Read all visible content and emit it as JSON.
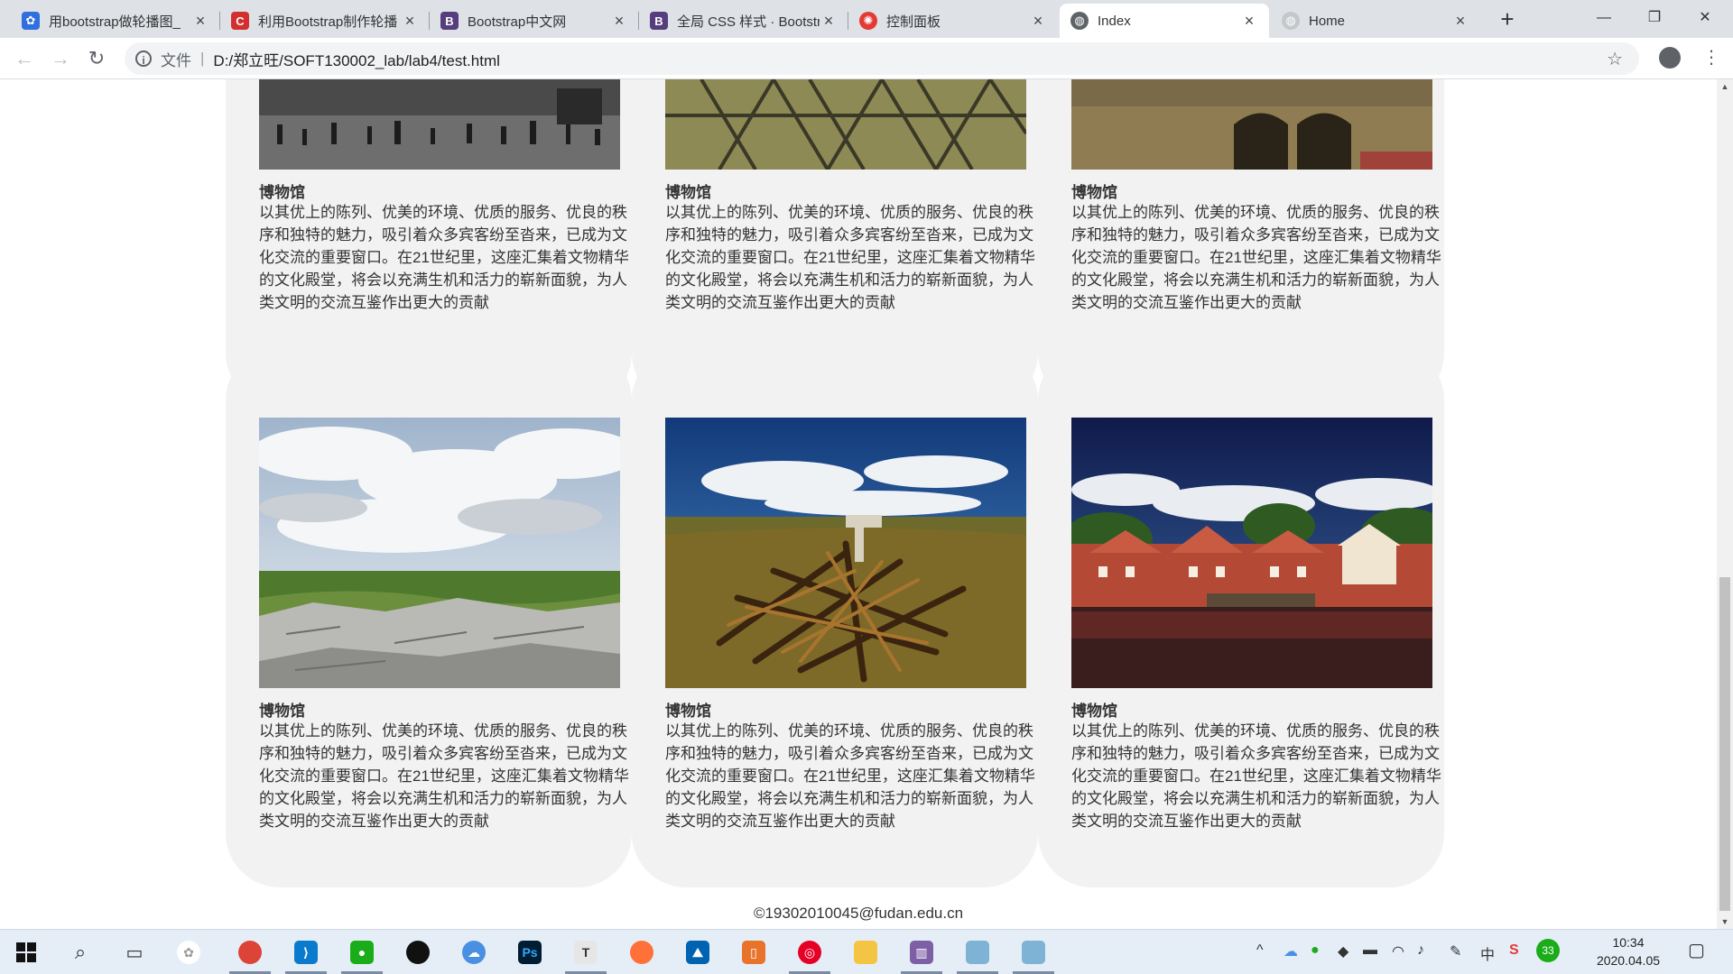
{
  "browser": {
    "tabs": [
      {
        "title": "用bootstrap做轮播图_",
        "icon": "baidu-paw-icon",
        "color": "#2f6fde"
      },
      {
        "title": "利用Bootstrap制作轮播",
        "icon": "csdn-icon",
        "color": "#d32f2f"
      },
      {
        "title": "Bootstrap中文网",
        "icon": "bootstrap-icon",
        "color": "#563d7c"
      },
      {
        "title": "全局 CSS 样式 · Bootstrap",
        "icon": "bootstrap-icon",
        "color": "#563d7c"
      },
      {
        "title": "控制面板",
        "icon": "gear-icon",
        "color": "#e53935"
      },
      {
        "title": "Index",
        "icon": "globe-icon",
        "color": "#5f6368"
      },
      {
        "title": "Home",
        "icon": "globe-icon",
        "color": "#9aa0a6"
      }
    ],
    "active_tab_index": 5,
    "new_tab_label": "+",
    "address": {
      "scheme_label": "文件",
      "separator": "|",
      "url": "D:/郑立旺/SOFT130002_lab/lab4/test.html"
    }
  },
  "page": {
    "cards": [
      {
        "title": "博物馆",
        "desc": "以其优上的陈列、优美的环境、优质的服务、优良的秩序和独特的魅力，吸引着众多宾客纷至沓来，已成为文化交流的重要窗口。在21世纪里，这座汇集着文物精华的文化殿堂，将会以充满生机和活力的崭新面貌，为人类文明的交流互鉴作出更大的贡献",
        "image": "black-white-plaza-crowd"
      },
      {
        "title": "博物馆",
        "desc": "以其优上的陈列、优美的环境、优质的服务、优良的秩序和独特的魅力，吸引着众多宾客纷至沓来，已成为文化交流的重要窗口。在21世纪里，这座汇集着文物精华的文化殿堂，将会以充满生机和活力的崭新面貌，为人类文明的交流互鉴作出更大的贡献",
        "image": "glass-roof-structure"
      },
      {
        "title": "博物馆",
        "desc": "以其优上的陈列、优美的环境、优质的服务、优良的秩序和独特的魅力，吸引着众多宾客纷至沓来，已成为文化交流的重要窗口。在21世纪里，这座汇集着文物精华的文化殿堂，将会以充满生机和活力的崭新面貌，为人类文明的交流互鉴作出更大的贡献",
        "image": "stone-wall-arches"
      },
      {
        "title": "博物馆",
        "desc": "以其优上的陈列、优美的环境、优质的服务、优良的秩序和独特的魅力，吸引着众多宾客纷至沓来，已成为文化交流的重要窗口。在21世纪里，这座汇集着文物精华的文化殿堂，将会以充满生机和活力的崭新面貌，为人类文明的交流互鉴作出更大的贡献",
        "image": "cloudy-sky-rocky-field"
      },
      {
        "title": "博物馆",
        "desc": "以其优上的陈列、优美的环境、优质的服务、优良的秩序和独特的魅力，吸引着众多宾客纷至沓来，已成为文化交流的重要窗口。在21世纪里，这座汇集着文物精华的文化殿堂，将会以充满生机和活力的崭新面貌，为人类文明的交流互鉴作出更大的贡献",
        "image": "driftwood-pile-field"
      },
      {
        "title": "博物馆",
        "desc": "以其优上的陈列、优美的环境、优质的服务、优良的秩序和独特的魅力，吸引着众多宾客纷至沓来，已成为文化交流的重要窗口。在21世纪里，这座汇集着文物精华的文化殿堂，将会以充满生机和活力的崭新面貌，为人类文明的交流互鉴作出更大的贡献",
        "image": "harbor-red-houses"
      }
    ],
    "footer": "©19302010045@fudan.edu.cn",
    "card_bg_color": "#f2f2f2"
  },
  "taskbar": {
    "apps": [
      {
        "name": "chrome",
        "icon": "chrome-icon",
        "color": "#db4437",
        "label": "",
        "running": true
      },
      {
        "name": "vscode",
        "icon": "vscode-icon",
        "color": "#0a7acc",
        "label": "",
        "running": true
      },
      {
        "name": "wechat",
        "icon": "wechat-icon",
        "color": "#1aad19",
        "label": "",
        "running": true
      },
      {
        "name": "qq",
        "icon": "qq-penguin-icon",
        "color": "#111111",
        "label": "",
        "running": false
      },
      {
        "name": "baidu-netdisk",
        "icon": "cloud-icon",
        "color": "#4a90e2",
        "label": "",
        "running": false
      },
      {
        "name": "photoshop",
        "icon": "photoshop-icon",
        "color": "#001d34",
        "label": "Ps",
        "running": false
      },
      {
        "name": "typora",
        "icon": "typora-icon",
        "color": "#e6e6e6",
        "label": "T",
        "running": true
      },
      {
        "name": "firefox",
        "icon": "firefox-icon",
        "color": "#ff7139",
        "label": "",
        "running": false
      },
      {
        "name": "photos",
        "icon": "photos-icon",
        "color": "#0063b1",
        "label": "",
        "running": false
      },
      {
        "name": "wps",
        "icon": "wps-icon",
        "color": "#e8732b",
        "label": "",
        "running": false
      },
      {
        "name": "netease-music",
        "icon": "music-icon",
        "color": "#e60026",
        "label": "",
        "running": true
      },
      {
        "name": "file-explorer",
        "icon": "folder-icon",
        "color": "#f4c542",
        "label": "",
        "running": false
      },
      {
        "name": "winrar",
        "icon": "archive-icon",
        "color": "#7d5fa6",
        "label": "",
        "running": true
      },
      {
        "name": "notes-1",
        "icon": "note-icon",
        "color": "#7fb3d5",
        "label": "",
        "running": true
      },
      {
        "name": "notes-2",
        "icon": "note-icon",
        "color": "#7fb3d5",
        "label": "",
        "running": true
      }
    ],
    "tray": {
      "ime": "中",
      "time": "10:34",
      "date": "2020.04.05",
      "badge": "33"
    }
  }
}
